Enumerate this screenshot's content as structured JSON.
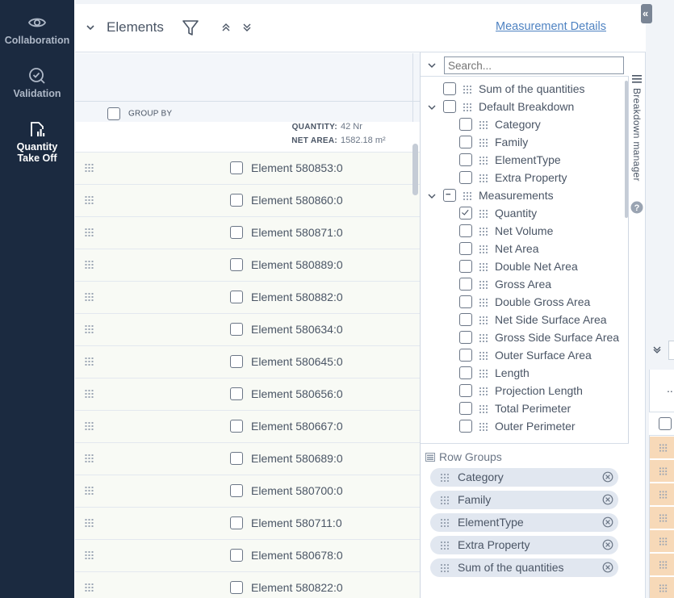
{
  "sidebar": {
    "items": [
      {
        "label": "Collaboration",
        "icon": "eye-icon"
      },
      {
        "label": "Validation",
        "icon": "check-circle-icon"
      },
      {
        "label": "Quantity\nTake Off",
        "label_line1": "Quantity",
        "label_line2": "Take Off",
        "icon": "quantity-takeoff-icon",
        "active": true
      }
    ]
  },
  "header": {
    "title": "Elements",
    "link": "Measurement Details"
  },
  "grid": {
    "group_by_label": "GROUP BY",
    "summary": {
      "quantity_label": "QUANTITY:",
      "quantity_value": "42 Nr",
      "net_area_label": "NET AREA:",
      "net_area_value": "1582.18 m²"
    },
    "rows": [
      "Element 580853:0",
      "Element 580860:0",
      "Element 580871:0",
      "Element 580889:0",
      "Element 580882:0",
      "Element 580634:0",
      "Element 580645:0",
      "Element 580656:0",
      "Element 580667:0",
      "Element 580689:0",
      "Element 580700:0",
      "Element 580711:0",
      "Element 580678:0",
      "Element 580822:0"
    ]
  },
  "breakdown_manager": {
    "tab_label": "Breakdown manager",
    "search_placeholder": "Search...",
    "tree": [
      {
        "label": "Sum of the quantities",
        "level": 0,
        "toggle": "none",
        "checked": false,
        "grip": true
      },
      {
        "label": "Default Breakdown",
        "level": 0,
        "toggle": "expanded",
        "checked": false,
        "grip": true
      },
      {
        "label": "Category",
        "level": 1,
        "checked": false
      },
      {
        "label": "Family",
        "level": 1,
        "checked": false
      },
      {
        "label": "ElementType",
        "level": 1,
        "checked": false
      },
      {
        "label": "Extra Property",
        "level": 1,
        "checked": false
      },
      {
        "label": "Measurements",
        "level": 0,
        "toggle": "expanded",
        "checked": "partial",
        "grip": true
      },
      {
        "label": "Quantity",
        "level": 1,
        "checked": true
      },
      {
        "label": "Net Volume",
        "level": 1,
        "checked": false
      },
      {
        "label": "Net Area",
        "level": 1,
        "checked": false
      },
      {
        "label": "Double Net Area",
        "level": 1,
        "checked": false
      },
      {
        "label": "Gross Area",
        "level": 1,
        "checked": false
      },
      {
        "label": "Double Gross Area",
        "level": 1,
        "checked": false
      },
      {
        "label": "Net Side Surface Area",
        "level": 1,
        "checked": false
      },
      {
        "label": "Gross Side Surface Area",
        "level": 1,
        "checked": false
      },
      {
        "label": "Outer Surface Area",
        "level": 1,
        "checked": false
      },
      {
        "label": "Length",
        "level": 1,
        "checked": false
      },
      {
        "label": "Projection Length",
        "level": 1,
        "checked": false
      },
      {
        "label": "Total Perimeter",
        "level": 1,
        "checked": false
      },
      {
        "label": "Outer Perimeter",
        "level": 1,
        "checked": false
      }
    ],
    "row_groups_label": "Row Groups",
    "row_groups": [
      "Category",
      "Family",
      "ElementType",
      "Extra Property",
      "Sum of the quantities"
    ]
  },
  "edge": {
    "collapse_symbol": "«",
    "dots": "..."
  },
  "colors": {
    "sidebar_bg": "#1b2a40",
    "link": "#4f83c2",
    "row_bg": "#f8faf5",
    "chip_bg": "#e1e7f0",
    "orange_row": "#f7d9b8"
  }
}
